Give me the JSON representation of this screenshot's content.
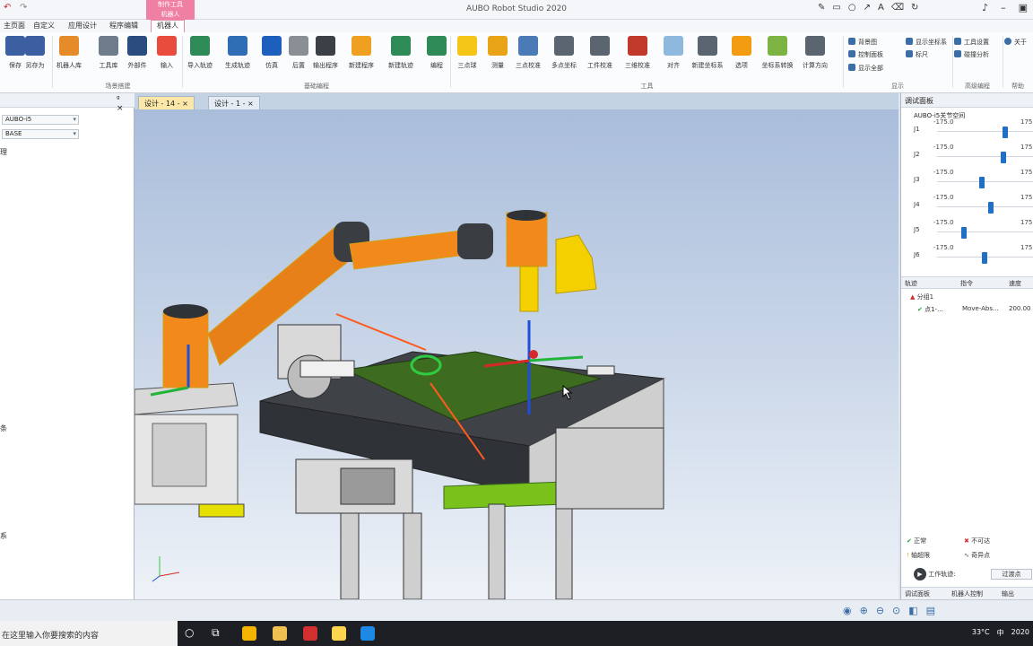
{
  "app": {
    "title": "AUBO Robot Studio 2020",
    "context_tab_group": "制作工具",
    "context_tab": "机器人"
  },
  "menu_tabs": [
    "主页面",
    "自定义",
    "应用设计",
    "程序编辑",
    "机器人"
  ],
  "ribbon": {
    "buttons": [
      {
        "label": "保存",
        "icon": "save-icon",
        "color": "#3b5fa0"
      },
      {
        "label": "另存为",
        "icon": "save-as-icon",
        "color": "#3b5fa0"
      },
      {
        "label": "机器人库",
        "icon": "robot-library-icon",
        "color": "#e58b2a"
      },
      {
        "label": "工具库",
        "icon": "tool-library-icon",
        "color": "#6f7c8b"
      },
      {
        "label": "外部件",
        "icon": "external-part-icon",
        "color": "#2b4c7e"
      },
      {
        "label": "输入",
        "icon": "import-icon",
        "color": "#e94b3c"
      },
      {
        "label": "导入轨迹",
        "icon": "import-trajectory-icon",
        "color": "#2e8b57"
      },
      {
        "label": "生成轨迹",
        "icon": "generate-trajectory-icon",
        "color": "#2f6db5"
      },
      {
        "label": "仿真",
        "icon": "simulate-icon",
        "color": "#1c5fbd"
      },
      {
        "label": "后置",
        "icon": "post-process-icon",
        "color": "#8a8f96"
      },
      {
        "label": "输出程序",
        "icon": "output-program-icon",
        "color": "#3b3f46"
      },
      {
        "label": "新建程序",
        "icon": "new-program-icon",
        "color": "#f0a020"
      },
      {
        "label": "新建轨迹",
        "icon": "new-trajectory-icon",
        "color": "#2e8b57"
      },
      {
        "label": "编程",
        "icon": "programming-icon",
        "color": "#2e8b57"
      },
      {
        "label": "三点球",
        "icon": "three-point-sphere-icon",
        "color": "#f5c518"
      },
      {
        "label": "测量",
        "icon": "measure-icon",
        "color": "#e8a317"
      },
      {
        "label": "三点校准",
        "icon": "three-point-calibrate-icon",
        "color": "#4a7bb7"
      },
      {
        "label": "多点坐标",
        "icon": "multi-point-icon",
        "color": "#5b6570"
      },
      {
        "label": "工件校准",
        "icon": "workpiece-calibrate-icon",
        "color": "#5b6570"
      },
      {
        "label": "三维校准",
        "icon": "3d-calibrate-icon",
        "color": "#c0392b"
      },
      {
        "label": "对齐",
        "icon": "align-icon",
        "color": "#8fb8de"
      },
      {
        "label": "新建坐标系",
        "icon": "new-frame-icon",
        "color": "#5b6570"
      },
      {
        "label": "选项",
        "icon": "options-icon",
        "color": "#f39c12"
      },
      {
        "label": "坐标系转换",
        "icon": "frame-transform-icon",
        "color": "#7cb342"
      },
      {
        "label": "计算方向",
        "icon": "compute-direction-icon",
        "color": "#5b6570"
      }
    ],
    "groups": [
      "场景搭建",
      "基础编程",
      "工具",
      "显示",
      "高级编程",
      "帮助"
    ],
    "display_items": [
      "背景图",
      "显示坐标系",
      "控制面板",
      "标尺",
      "显示全部"
    ],
    "advanced_items": [
      "工具设置",
      "碰撞分析"
    ],
    "help_items": [
      "关于"
    ]
  },
  "left_panel": {
    "robot_select": "AUBO-i5",
    "frame_select": "BASE",
    "tree_label": "理",
    "side_labels": [
      "条",
      "系"
    ]
  },
  "doc_tabs": [
    {
      "label": "设计 - 14 - ×",
      "active": true
    },
    {
      "label": "设计 - 1 - ×",
      "active": false
    }
  ],
  "right_panel": {
    "title": "调试面板",
    "joint_space_title": "AUBO-i5关节空间",
    "joints": [
      {
        "name": "J1",
        "min": "-175.0",
        "max": "175.0",
        "value": 0.72
      },
      {
        "name": "J2",
        "min": "-175.0",
        "max": "175.0",
        "value": 0.7
      },
      {
        "name": "J3",
        "min": "-175.0",
        "max": "175.0",
        "value": 0.46
      },
      {
        "name": "J4",
        "min": "-175.0",
        "max": "175.0",
        "value": 0.56
      },
      {
        "name": "J5",
        "min": "-175.0",
        "max": "175.0",
        "value": 0.26
      },
      {
        "name": "J6",
        "min": "-175.0",
        "max": "175.0",
        "value": 0.49
      }
    ],
    "table_headers": [
      "轨迹",
      "指令",
      "速度"
    ],
    "table_rows": [
      {
        "name": "分组1",
        "cmd": "",
        "speed": ""
      },
      {
        "name": "点1-...",
        "cmd": "Move-Abs...",
        "speed": "200.00"
      }
    ],
    "legend": [
      {
        "label": "正常",
        "icon": "check-icon",
        "color": "#2e9e3a"
      },
      {
        "label": "不可达",
        "icon": "cross-icon",
        "color": "#d32f2f"
      },
      {
        "label": "轴超限",
        "icon": "warning-icon",
        "color": "#e6a800"
      },
      {
        "label": "奇异点",
        "icon": "singular-icon",
        "color": "#555555"
      }
    ],
    "work_trajectory": "工作轨迹:",
    "trajectory_btn": "过渡点",
    "bottom_tabs": [
      "调试面板",
      "机器人控制",
      "输出"
    ]
  },
  "status": {
    "search_placeholder": "在这里输入你要搜索的内容",
    "temperature": "33°C",
    "ime": "中",
    "clock": "2020"
  }
}
